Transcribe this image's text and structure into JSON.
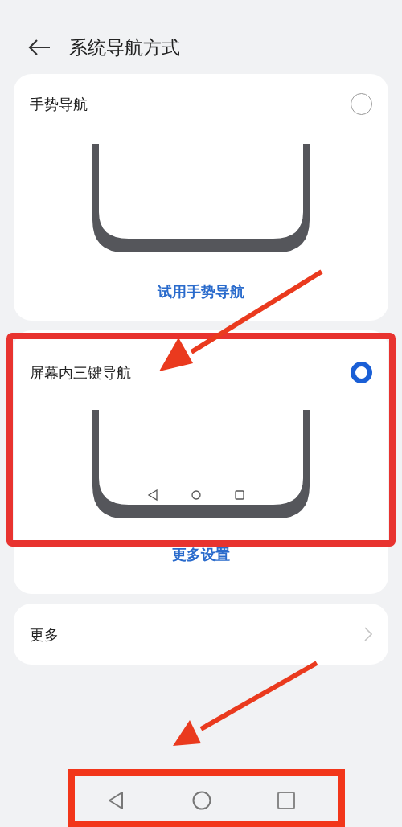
{
  "header": {
    "title": "系统导航方式"
  },
  "options": [
    {
      "kind": "gesture",
      "label": "手势导航",
      "selected": false,
      "link": "试用手势导航"
    },
    {
      "kind": "three_key",
      "label": "屏幕内三键导航",
      "selected": true,
      "link": "更多设置"
    }
  ],
  "more": {
    "label": "更多"
  }
}
